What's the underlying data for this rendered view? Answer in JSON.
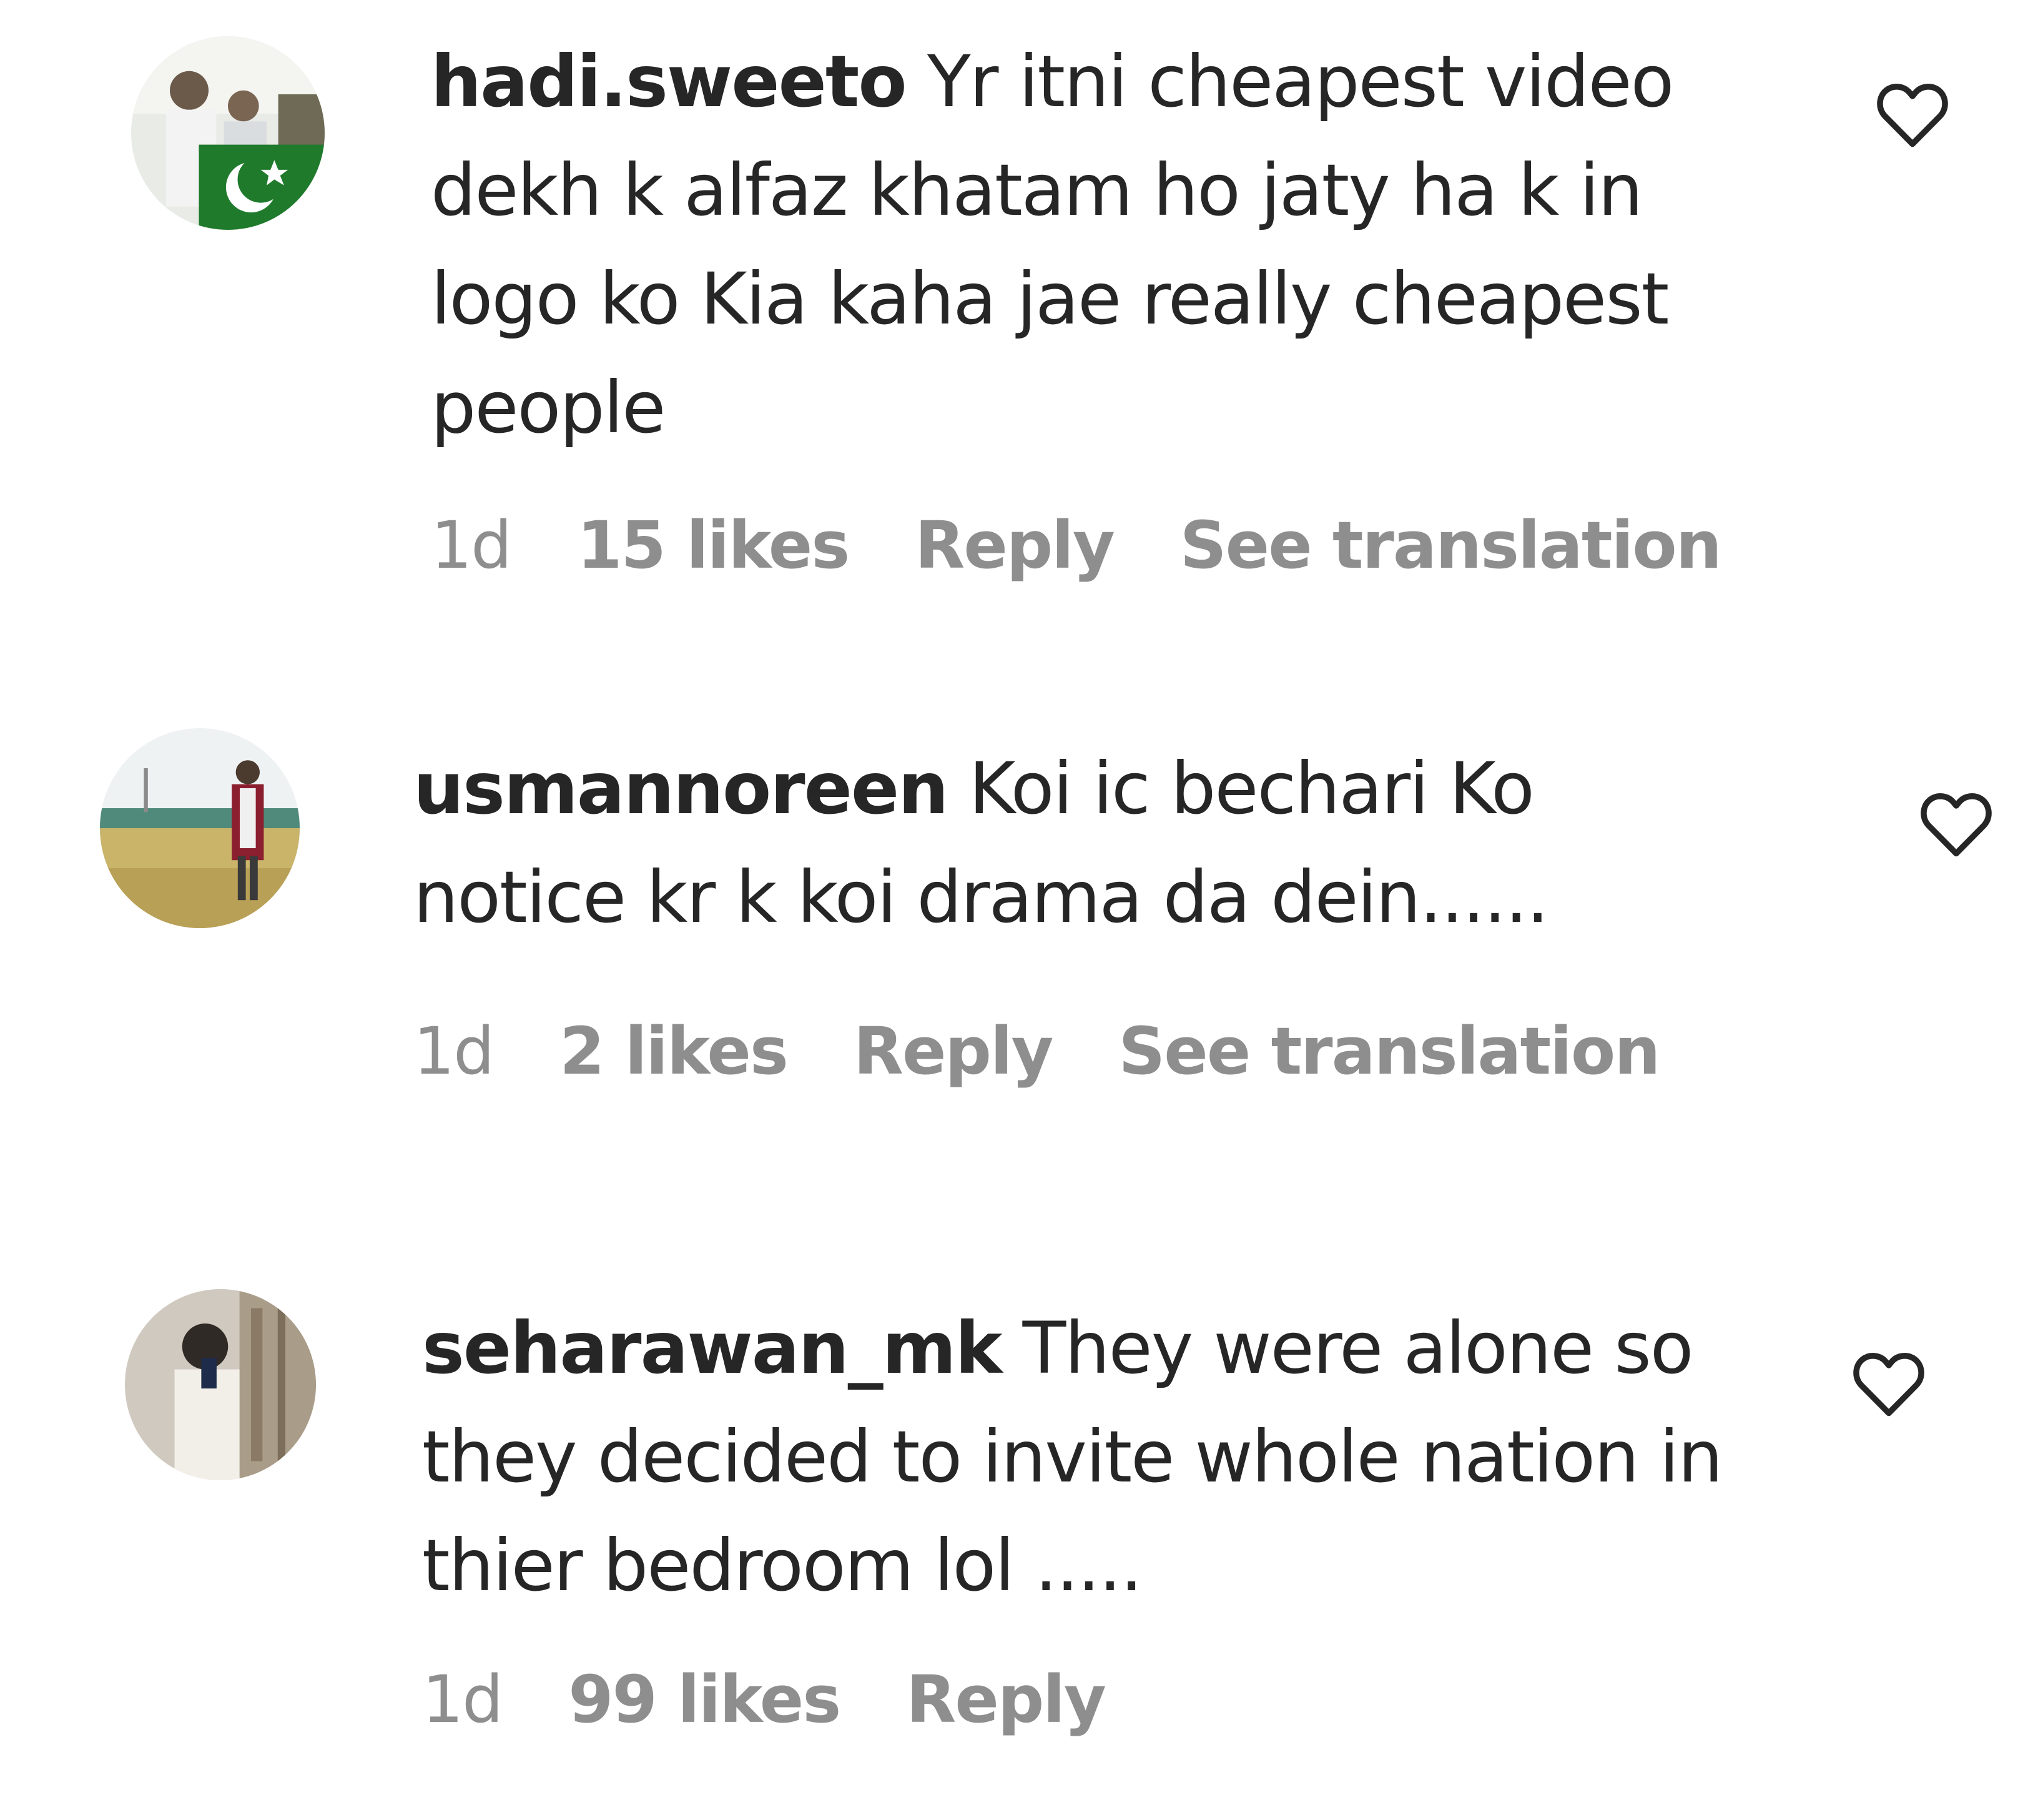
{
  "comments": [
    {
      "username": "hadi.sweeto",
      "text": "Yr itni cheapest video dekh k alfaz khatam ho jaty ha k in logo ko Kia kaha jae really cheapest people",
      "time": "1d",
      "likes": "15 likes",
      "reply_label": "Reply",
      "translation_label": "See translation"
    },
    {
      "username": "usmannoreen",
      "text": "Koi ic bechari Ko notice kr k koi drama da dein......",
      "time": "1d",
      "likes": "2 likes",
      "reply_label": "Reply",
      "translation_label": "See translation"
    },
    {
      "username": "seharawan_mk",
      "text": "They were alone so they decided to invite whole nation in thier bedroom lol .....",
      "time": "1d",
      "likes": "99 likes",
      "reply_label": "Reply"
    }
  ],
  "icons": {
    "like": "heart-outline-icon",
    "avatar": "user-avatar"
  },
  "colors": {
    "text": "#262626",
    "meta": "#8e8e8e",
    "background": "#ffffff"
  }
}
